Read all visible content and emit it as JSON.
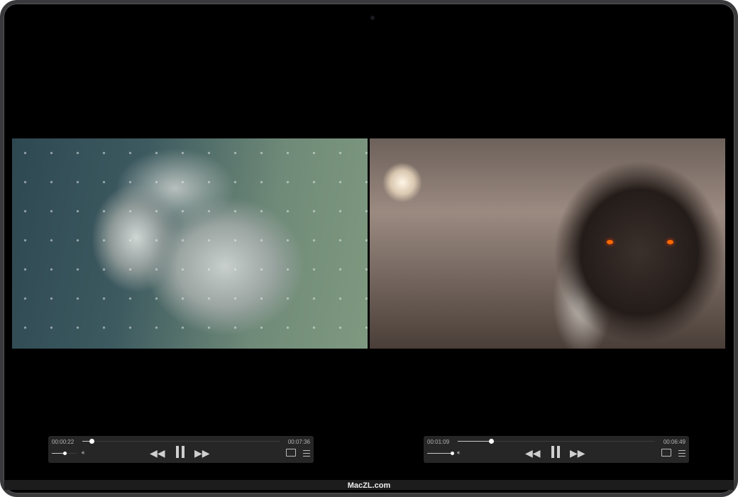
{
  "players": [
    {
      "current_time": "00:00:22",
      "duration": "00:07:36",
      "progress_fraction": 0.048,
      "volume_fraction": 0.5,
      "video": "snow wolf artwork"
    },
    {
      "current_time": "00:01:09",
      "duration": "00:06:49",
      "progress_fraction": 0.169,
      "volume_fraction": 1.0,
      "video": "dark wolf with glowing eyes artwork"
    }
  ],
  "icons": {
    "rewind": "⏪",
    "pause": "pause-icon",
    "forward": "⏩",
    "volume": "🔉"
  },
  "watermark": "MacZL.com"
}
